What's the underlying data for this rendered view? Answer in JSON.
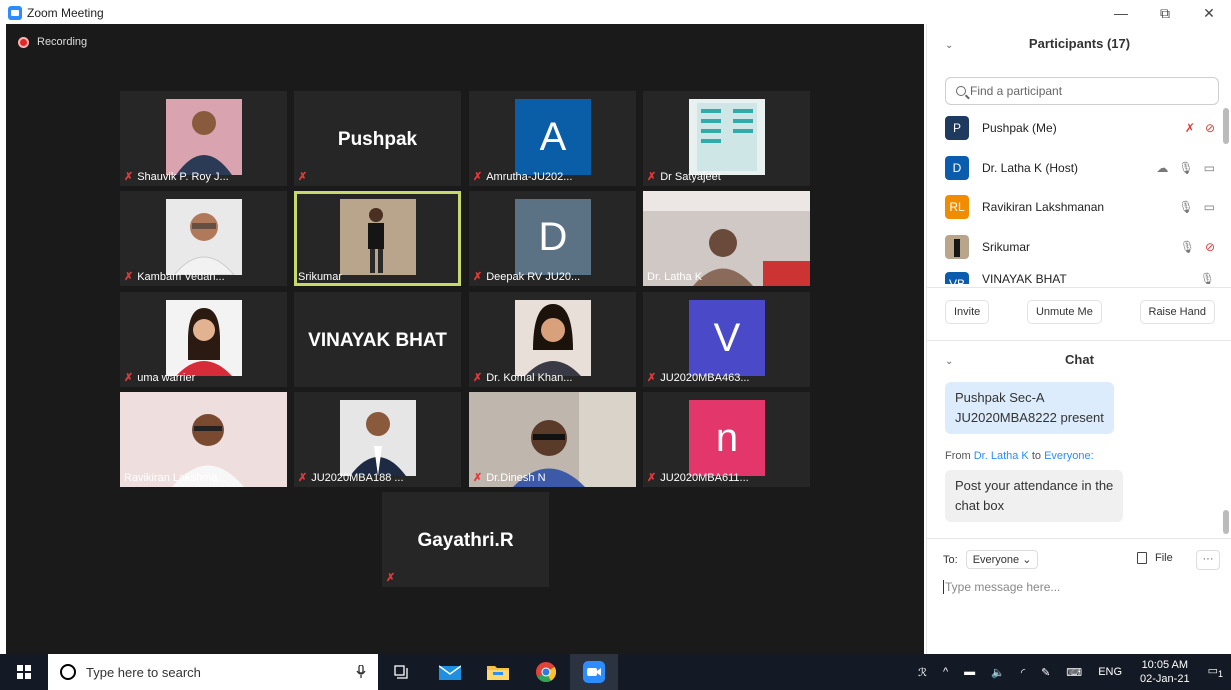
{
  "window": {
    "title": "Zoom Meeting",
    "controls": [
      "—",
      "⧉",
      "✕"
    ]
  },
  "recording": {
    "label": "Recording"
  },
  "tiles": [
    {
      "name": "Shauvik P. Roy J...",
      "muted": true,
      "kind": "photo",
      "photo": "man-suit"
    },
    {
      "name": "",
      "muted": true,
      "kind": "text",
      "display": "Pushpak"
    },
    {
      "name": "Amrutha-JU202...",
      "muted": true,
      "kind": "letter",
      "letter": "A",
      "color": "#0a5ea8"
    },
    {
      "name": "Dr Satyajeet",
      "muted": true,
      "kind": "photo",
      "photo": "document"
    },
    {
      "name": "Kambam Vedan...",
      "muted": true,
      "kind": "photo",
      "photo": "older-man"
    },
    {
      "name": "Srikumar",
      "muted": false,
      "kind": "photo",
      "photo": "standing-man",
      "active": true
    },
    {
      "name": "Deepak RV JU20...",
      "muted": true,
      "kind": "letter",
      "letter": "D",
      "color": "#5a7284"
    },
    {
      "name": "Dr. Latha K",
      "muted": false,
      "kind": "photo",
      "photo": "room-woman"
    },
    {
      "name": "uma warrier",
      "muted": true,
      "kind": "photo",
      "photo": "woman"
    },
    {
      "name": "",
      "muted": false,
      "kind": "text",
      "display": "VINAYAK BHAT"
    },
    {
      "name": "Dr. Komal Khan...",
      "muted": true,
      "kind": "photo",
      "photo": "woman-smile"
    },
    {
      "name": "JU2020MBA463...",
      "muted": true,
      "kind": "letter",
      "letter": "V",
      "color": "#4a4ac8"
    },
    {
      "name": "Ravikiran Lakshma...",
      "muted": false,
      "kind": "photo",
      "photo": "man-glasses"
    },
    {
      "name": "JU2020MBA188 ...",
      "muted": true,
      "kind": "photo",
      "photo": "man-formal"
    },
    {
      "name": "Dr.Dinesh N",
      "muted": true,
      "kind": "photo",
      "photo": "bald-man"
    },
    {
      "name": "JU2020MBA611...",
      "muted": true,
      "kind": "letter",
      "letter": "n",
      "color": "#e3366b"
    },
    {
      "name": "",
      "muted": true,
      "kind": "text",
      "display": "Gayathri.R"
    }
  ],
  "participants": {
    "header": "Participants (17)",
    "search_placeholder": "Find a participant",
    "list": [
      {
        "initials": "P",
        "name": "Pushpak (Me)",
        "color": "#1f3a5f",
        "icons": "muted"
      },
      {
        "initials": "D",
        "name": "Dr. Latha K (Host)",
        "color": "#0b5cad",
        "icons": "host"
      },
      {
        "initials": "RL",
        "name": "Ravikiran Lakshmanan",
        "color": "#f08c00",
        "icons": "on"
      },
      {
        "initials": "",
        "name": "Srikumar",
        "color": "#3a3a3a",
        "icons": "video-off"
      },
      {
        "initials": "VB",
        "name": "VINAYAK BHAT",
        "color": "#0b5cad",
        "icons": "partial"
      }
    ],
    "buttons": {
      "invite": "Invite",
      "unmute": "Unmute Me",
      "raise": "Raise Hand"
    }
  },
  "chat": {
    "header": "Chat",
    "messages": [
      {
        "text_line1": "Pushpak Sec-A",
        "text_line2": "JU2020MBA8222 present",
        "bg": "#dcecfc"
      },
      {
        "from_prefix": "From",
        "from": "Dr. Latha K",
        "to_word": "to",
        "to": "Everyone:",
        "text_line1": "Post your attendance in the",
        "text_line2": "chat box",
        "bg": "#f0f0f0"
      }
    ],
    "to_label": "To:",
    "to_value": "Everyone ⌄",
    "file_label": "File",
    "more_label": "···",
    "input_placeholder": "Type message here..."
  },
  "taskbar": {
    "search_text": "Type here to search",
    "lang": "ENG",
    "time": "10:05 AM",
    "date": "02-Jan-21",
    "badge": "1"
  }
}
